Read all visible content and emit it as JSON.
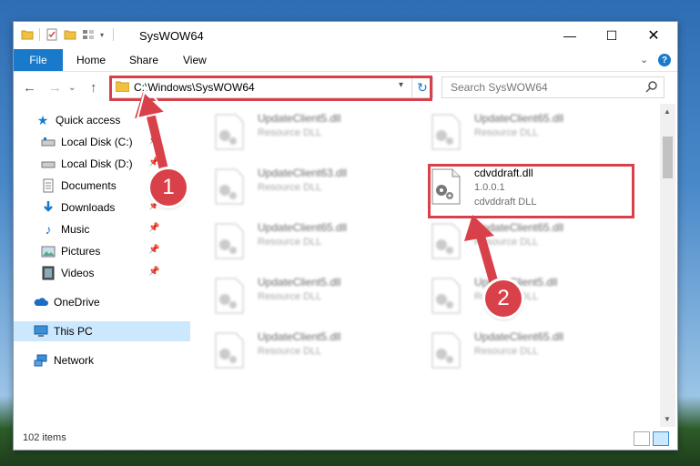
{
  "window": {
    "title": "SysWOW64"
  },
  "ribbon": {
    "tabs": [
      "File",
      "Home",
      "Share",
      "View"
    ],
    "help": "?"
  },
  "address": {
    "path": "C:\\Windows\\SysWOW64"
  },
  "search": {
    "placeholder": "Search SysWOW64"
  },
  "sidebar": {
    "items": [
      {
        "label": "Quick access",
        "icon": "star-icon"
      },
      {
        "label": "Local Disk (C:)",
        "icon": "drive-icon"
      },
      {
        "label": "Local Disk (D:)",
        "icon": "drive-icon"
      },
      {
        "label": "Documents",
        "icon": "documents-icon"
      },
      {
        "label": "Downloads",
        "icon": "download-icon"
      },
      {
        "label": "Music",
        "icon": "music-icon"
      },
      {
        "label": "Pictures",
        "icon": "pictures-icon"
      },
      {
        "label": "Videos",
        "icon": "videos-icon"
      },
      {
        "label": "OneDrive",
        "icon": "cloud-icon"
      },
      {
        "label": "This PC",
        "icon": "computer-icon"
      },
      {
        "label": "Network",
        "icon": "network-icon"
      }
    ]
  },
  "files": [
    {
      "name": "UpdateClient5.dll",
      "desc": "Resource DLL"
    },
    {
      "name": "UpdateClient65.dll",
      "desc": "Resource DLL"
    },
    {
      "name": "UpdateClient63.dll",
      "desc": "Resource DLL"
    },
    {
      "name": "cdvddraft.dll",
      "version": "1.0.0.1",
      "desc": "cdvddraft DLL"
    },
    {
      "name": "UpdateClient65.dll",
      "desc": "Resource DLL"
    },
    {
      "name": "UpdateClient65.dll",
      "desc": "Resource DLL"
    },
    {
      "name": "UpdateClient5.dll",
      "desc": "Resource DLL"
    },
    {
      "name": "UpdateClient5.dll",
      "desc": "Resource DLL"
    },
    {
      "name": "UpdateClient5.dll",
      "desc": "Resource DLL"
    },
    {
      "name": "UpdateClient65.dll",
      "desc": "Resource DLL"
    }
  ],
  "status": {
    "count": "102 items"
  },
  "callouts": [
    "1",
    "2"
  ],
  "colors": {
    "accent": "#1979ca",
    "highlight": "#d9414a",
    "selection": "#cce8ff"
  }
}
